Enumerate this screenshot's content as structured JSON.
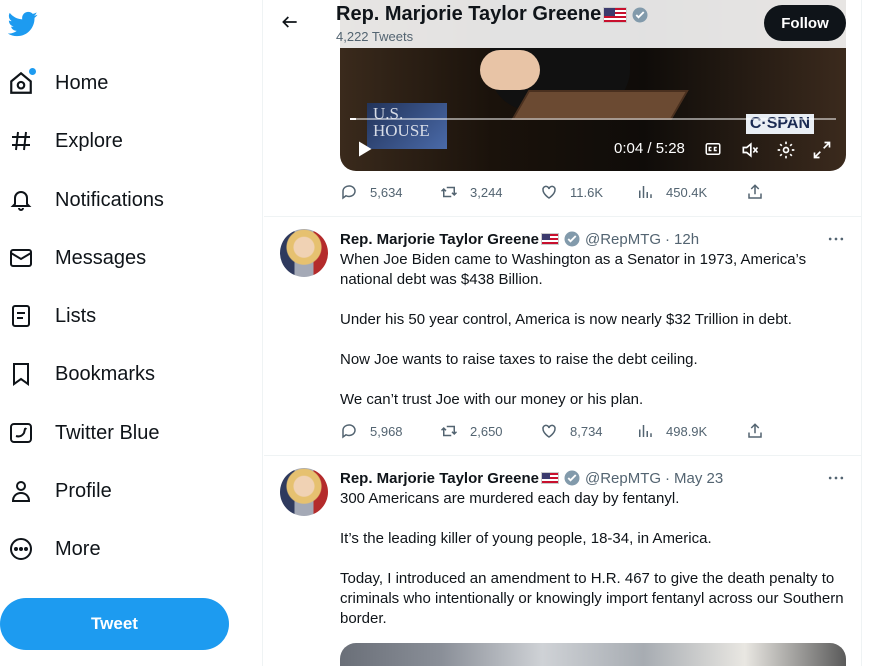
{
  "sidebar": {
    "nav": [
      {
        "label": "Home",
        "icon": "home-icon"
      },
      {
        "label": "Explore",
        "icon": "hashtag-icon"
      },
      {
        "label": "Notifications",
        "icon": "bell-icon"
      },
      {
        "label": "Messages",
        "icon": "envelope-icon"
      },
      {
        "label": "Lists",
        "icon": "list-icon"
      },
      {
        "label": "Bookmarks",
        "icon": "bookmark-icon"
      },
      {
        "label": "Twitter Blue",
        "icon": "twitter-blue-icon"
      },
      {
        "label": "Profile",
        "icon": "person-icon"
      },
      {
        "label": "More",
        "icon": "more-circle-icon"
      }
    ],
    "tweet_button": "Tweet"
  },
  "header": {
    "name": "Rep. Marjorie Taylor Greene",
    "tweet_count": "4,222 Tweets",
    "follow_label": "Follow"
  },
  "video": {
    "watermark_left": "U.S.\nHOUSE",
    "watermark_right": "C·SPAN",
    "time": "0:04 / 5:28",
    "progress": 0.0125
  },
  "tweets": [
    {
      "stats": {
        "replies": "5,634",
        "retweets": "3,244",
        "likes": "11.6K",
        "views": "450.4K"
      }
    },
    {
      "name": "Rep. Marjorie Taylor Greene",
      "handle": "@RepMTG",
      "time": "12h",
      "paragraphs": [
        "When Joe Biden came to Washington as a Senator in 1973, America’s national debt was $438 Billion.",
        "Under his 50 year control, America is now nearly $32 Trillion in debt.",
        "Now Joe wants to raise taxes to raise the debt ceiling.",
        "We can’t trust Joe with our money or his plan."
      ],
      "stats": {
        "replies": "5,968",
        "retweets": "2,650",
        "likes": "8,734",
        "views": "498.9K"
      }
    },
    {
      "name": "Rep. Marjorie Taylor Greene",
      "handle": "@RepMTG",
      "time": "May 23",
      "paragraphs": [
        "300 Americans are murdered each day by fentanyl.",
        "It’s the leading killer of young people, 18-34, in America.",
        "Today, I introduced an amendment to H.R. 467 to give the death penalty to criminals who intentionally or knowingly import fentanyl across our Southern border."
      ]
    }
  ],
  "colors": {
    "accent": "#1d9bf0",
    "text": "#0f1419",
    "muted": "#536471",
    "border": "#eff3f4"
  }
}
